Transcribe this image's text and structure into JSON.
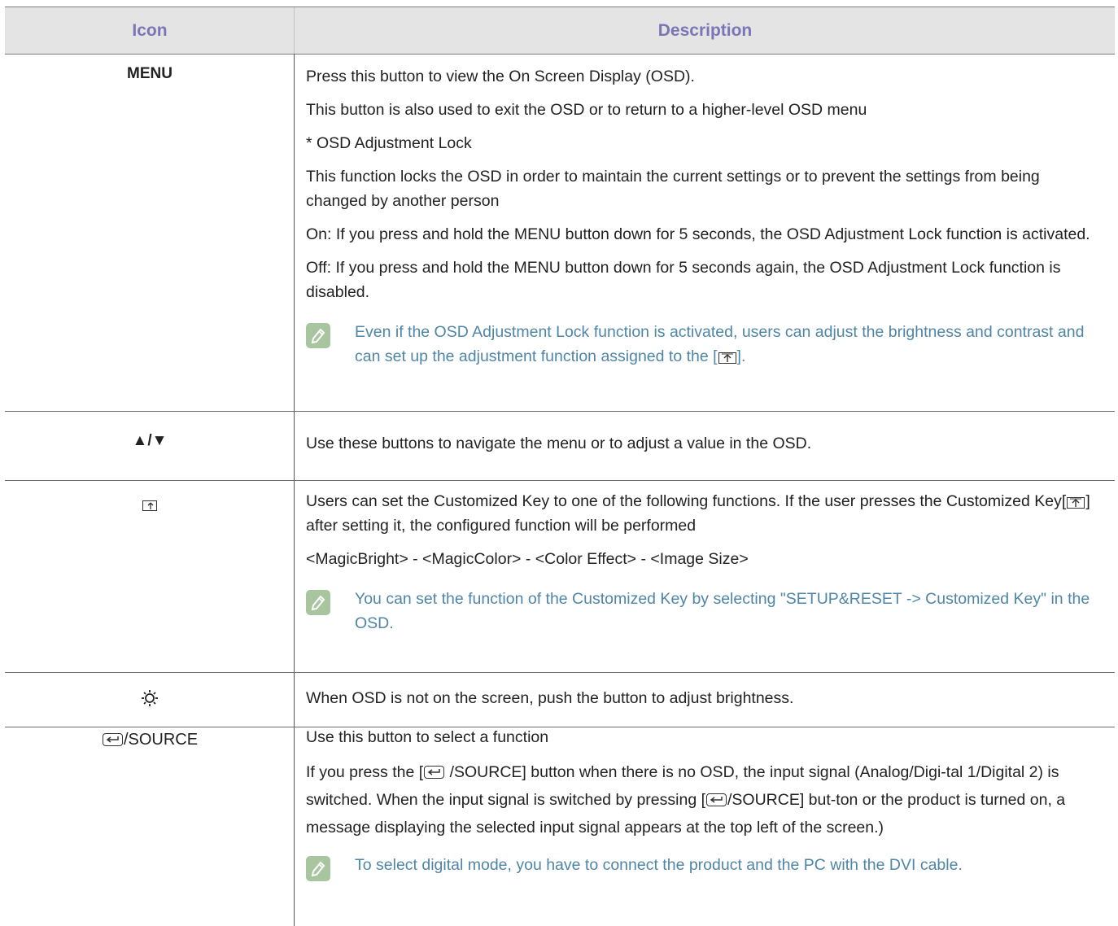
{
  "header": {
    "col_icon": "Icon",
    "col_desc": "Description"
  },
  "rows": [
    {
      "icon": "MENU",
      "paras": [
        "Press this button to view the On Screen Display (OSD).",
        "This button is also used to exit the OSD or to return to a higher-level OSD menu",
        "* OSD Adjustment Lock",
        "This function locks the OSD in order to maintain the current settings or to prevent the settings from being changed by another person",
        "On: If you press and hold the MENU button down for 5 seconds, the OSD Adjustment Lock function is activated.",
        "Off: If you press and hold the MENU button down for 5 seconds again, the OSD Adjustment Lock function is disabled."
      ],
      "note_a": "Even if the OSD Adjustment Lock function is activated, users can adjust the brightness and contrast and can set up the adjustment function assigned to the [",
      "note_b": "]."
    },
    {
      "icon": "▲/▼",
      "paras": [
        "Use these buttons to navigate the menu or to adjust a value in the OSD."
      ]
    },
    {
      "icon_name": "customized-key-icon",
      "p1a": "Users can set the Customized Key to one of the following functions. If the user presses the Customized Key[",
      "p1b": "] after setting it, the configured function will be performed",
      "p2": "<MagicBright> - <MagicColor> - <Color Effect> - <Image Size>",
      "note": "You can set the function of the Customized Key by selecting \"SETUP&RESET -> Customized Key\" in the OSD."
    },
    {
      "icon_name": "brightness-icon",
      "paras": [
        "When OSD is not on the screen, push the button to adjust brightness."
      ]
    },
    {
      "icon_suffix": "/SOURCE",
      "p1": "Use this button to select a function",
      "p2a": "If you press the [",
      "p2b": " /SOURCE] button when there is no OSD, the input signal (Analog/Digi-tal 1/Digital 2) is switched. When the input signal is switched by pressing [",
      "p2c": "/SOURCE] but-ton or the product is turned on, a message displaying the selected input signal appears at the top left of the screen.)",
      "note": "To select digital mode, you have to connect the product and the PC with the DVI cable."
    }
  ],
  "colors": {
    "header_text": "#7a76b6",
    "note_text": "#4f86a8",
    "note_icon_bg": "#a9c5a0",
    "header_bg": "#e4e4e4"
  }
}
